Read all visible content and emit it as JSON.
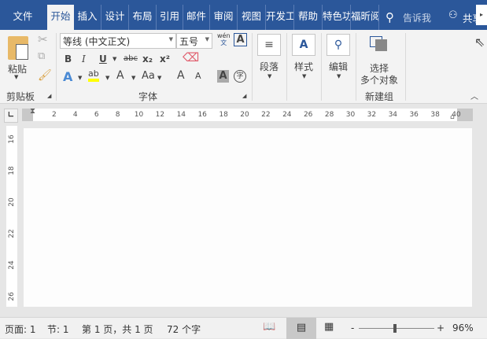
{
  "tabs": [
    {
      "label": "文件",
      "active": false
    },
    {
      "label": "开始",
      "active": true
    },
    {
      "label": "插入"
    },
    {
      "label": "设计"
    },
    {
      "label": "布局"
    },
    {
      "label": "引用"
    },
    {
      "label": "邮件"
    },
    {
      "label": "审阅"
    },
    {
      "label": "视图"
    },
    {
      "label": "开发工"
    },
    {
      "label": "帮助"
    },
    {
      "label": "特色功"
    },
    {
      "label": "福昕阅"
    }
  ],
  "tell_me": "告诉我",
  "share": "共享",
  "clipboard": {
    "paste": "粘贴",
    "group": "剪贴板"
  },
  "font": {
    "name": "等线 (中文正文)",
    "size": "五号",
    "group": "字体",
    "phonetic_top": "wén",
    "phonetic_bottom": "文",
    "bold": "B",
    "italic": "I",
    "underline": "U",
    "strike": "abc",
    "sub": "x₂",
    "sup": "x²",
    "text_effect": "A",
    "highlight": "ab",
    "font_color": "A",
    "case": "Aa",
    "grow": "A",
    "shrink": "A",
    "shading": "A",
    "enclose": "字",
    "border": "A"
  },
  "paragraph": {
    "label": "段落"
  },
  "styles": {
    "label": "样式"
  },
  "editing": {
    "label": "编辑"
  },
  "new_group": {
    "select_line1": "选择",
    "select_line2": "多个对象",
    "group": "新建组"
  },
  "ruler": {
    "h_ticks": [
      "2",
      "4",
      "6",
      "8",
      "10",
      "12",
      "14",
      "16",
      "18",
      "20",
      "22",
      "24",
      "26",
      "28",
      "30",
      "32",
      "34",
      "36",
      "38",
      "40"
    ],
    "v_ticks": [
      "16",
      "18",
      "20",
      "22",
      "24",
      "26"
    ]
  },
  "status": {
    "page": "页面: 1",
    "section": "节: 1",
    "pages": "第 1 页，共 1 页",
    "words": "72 个字",
    "zoom_minus": "-",
    "zoom_plus": "+",
    "zoom": "96%",
    "zoom_level_percent": 96
  },
  "colors": {
    "accent": "#2b579a",
    "highlight": "#ffff00"
  }
}
